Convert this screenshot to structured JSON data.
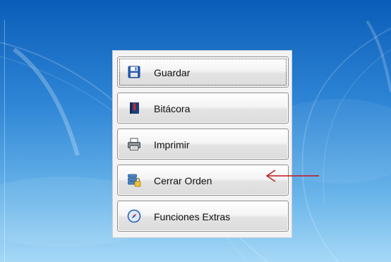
{
  "menu": {
    "items": [
      {
        "label": "Guardar",
        "icon": "floppy-disk-icon"
      },
      {
        "label": "Bitácora",
        "icon": "logbook-icon"
      },
      {
        "label": "Imprimir",
        "icon": "printer-icon"
      },
      {
        "label": "Cerrar Orden",
        "icon": "database-lock-icon"
      },
      {
        "label": "Funciones Extras",
        "icon": "compass-icon"
      }
    ]
  },
  "colors": {
    "desktop_top": "#0a5db8",
    "desktop_bottom": "#a6d8f6",
    "annotation_arrow": "#c0141c"
  }
}
